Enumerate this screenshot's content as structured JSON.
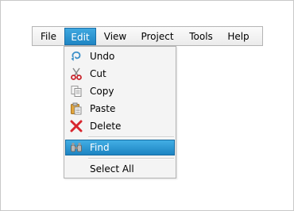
{
  "menubar": {
    "items": [
      {
        "label": "File"
      },
      {
        "label": "Edit"
      },
      {
        "label": "View"
      },
      {
        "label": "Project"
      },
      {
        "label": "Tools"
      },
      {
        "label": "Help"
      }
    ]
  },
  "dropdown": {
    "items": [
      {
        "label": "Undo",
        "icon": "undo-icon"
      },
      {
        "label": "Cut",
        "icon": "scissors-icon"
      },
      {
        "label": "Copy",
        "icon": "copy-icon"
      },
      {
        "label": "Paste",
        "icon": "paste-icon"
      },
      {
        "label": "Delete",
        "icon": "delete-icon"
      },
      {
        "label": "Find",
        "icon": "binoculars-icon"
      },
      {
        "label": "Select All",
        "icon": ""
      }
    ]
  },
  "colors": {
    "accent": "#2490cf",
    "delete_red": "#d8262e",
    "scissors_red": "#c8242c"
  }
}
